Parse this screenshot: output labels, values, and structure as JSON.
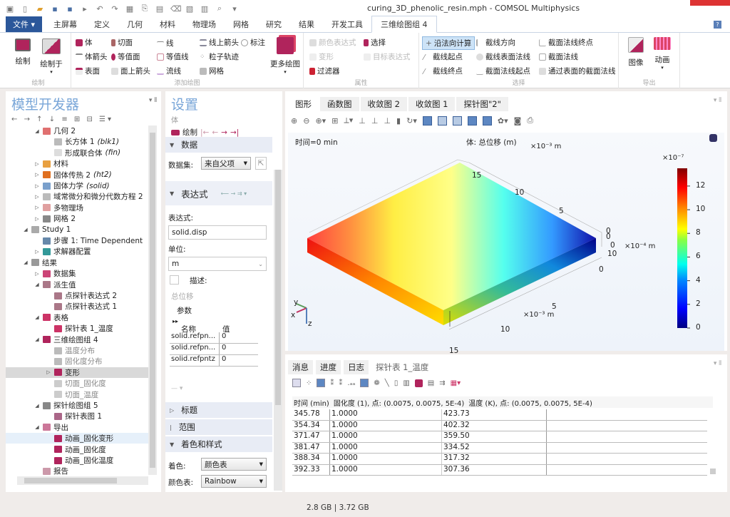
{
  "window": {
    "title": "curing_3D_phenolic_resin.mph - COMSOL Multiphysics"
  },
  "quick_access": [
    "app-icon",
    "new-icon",
    "open-icon",
    "save-icon",
    "save-as-icon",
    "run-icon",
    "undo-icon",
    "redo-icon",
    "table-icon",
    "cut-icon",
    "copy-icon",
    "delete-icon",
    "view-icon",
    "graph-icon",
    "zoom-icon",
    "more-icon"
  ],
  "ribbon_tabs": [
    {
      "label": "文件 ▾",
      "type": "file"
    },
    {
      "label": "主屏幕"
    },
    {
      "label": "定义"
    },
    {
      "label": "几何"
    },
    {
      "label": "材料"
    },
    {
      "label": "物理场"
    },
    {
      "label": "网格"
    },
    {
      "label": "研究"
    },
    {
      "label": "结果"
    },
    {
      "label": "开发工具"
    },
    {
      "label": "三维绘图组 4",
      "active": true
    }
  ],
  "ribbon": {
    "group_plot": {
      "label": "绘制",
      "plot": "绘制",
      "plot_in": "绘制于"
    },
    "group_add_plot": {
      "label": "添加绘图",
      "items": [
        "体",
        "体箭头",
        "表面",
        "切面",
        "等值面",
        "面上箭头",
        "线",
        "等值线",
        "流线",
        "线上箭头",
        "粒子轨迹",
        "网格",
        "标注"
      ],
      "more_plots": "更多绘图"
    },
    "group_attributes": {
      "label": "属性",
      "items": [
        {
          "label": "颜色表达式",
          "disabled": true
        },
        {
          "label": "选择"
        },
        {
          "label": "变形",
          "disabled": true
        },
        {
          "label": "目标表达式",
          "disabled": true
        },
        {
          "label": "过滤器"
        }
      ]
    },
    "group_selection": {
      "label": "选择",
      "items": [
        "沿法向计算",
        "截线方向",
        "截面法线终点",
        "截线起点",
        "截线表面法线",
        "截面法线",
        "截线终点",
        "截面法线起点",
        "通过表面的截面法线"
      ]
    },
    "group_export": {
      "label": "导出",
      "image": "图像",
      "animation": "动画"
    }
  },
  "model_builder": {
    "title": "模型开发器",
    "tree": [
      {
        "label": "几何 2",
        "level": 2,
        "toggle": "open",
        "color": "#e07070"
      },
      {
        "label": "长方体 1 ",
        "suffix": "(blk1)",
        "level": 3,
        "color": "#bbb"
      },
      {
        "label": "形成联合体 ",
        "suffix": "(fin)",
        "level": 3,
        "color": "#ddd"
      },
      {
        "label": "材料",
        "level": 2,
        "toggle": "closed",
        "color": "#e8a040"
      },
      {
        "label": "固体传热 2 ",
        "suffix": "(ht2)",
        "level": 2,
        "toggle": "closed",
        "color": "#e07020"
      },
      {
        "label": "固体力学 ",
        "suffix": "(solid)",
        "level": 2,
        "toggle": "closed",
        "color": "#7aa0cc"
      },
      {
        "label": "域常微分和微分代数方程 2",
        "level": 2,
        "toggle": "closed",
        "color": "#bbb"
      },
      {
        "label": "多物理场",
        "level": 2,
        "toggle": "closed",
        "color": "#e0a0a0"
      },
      {
        "label": "网格 2",
        "level": 2,
        "toggle": "closed",
        "color": "#888"
      },
      {
        "label": "Study 1",
        "level": 1,
        "toggle": "open",
        "color": "#aaa"
      },
      {
        "label": "步骤 1: Time Dependent",
        "level": 2,
        "color": "#6688aa"
      },
      {
        "label": "求解器配置",
        "level": 2,
        "toggle": "closed",
        "color": "#339999"
      },
      {
        "label": "结果",
        "level": 1,
        "toggle": "open",
        "color": "#999"
      },
      {
        "label": "数据集",
        "level": 2,
        "toggle": "closed",
        "color": "#cc4477"
      },
      {
        "label": "派生值",
        "level": 2,
        "toggle": "open",
        "color": "#aa7788"
      },
      {
        "label": "点探针表达式 2",
        "level": 3,
        "color": "#aa7788"
      },
      {
        "label": "点探针表达式 1",
        "level": 3,
        "color": "#aa7788"
      },
      {
        "label": "表格",
        "level": 2,
        "toggle": "open",
        "color": "#cc3366"
      },
      {
        "label": "探针表 1_温度",
        "level": 3,
        "color": "#cc3366"
      },
      {
        "label": "三维绘图组 4",
        "level": 2,
        "toggle": "open",
        "color": "#b0245c"
      },
      {
        "label": "温度分布",
        "level": 3,
        "color": "#bbb",
        "gray": true
      },
      {
        "label": "固化度分布",
        "level": 3,
        "color": "#bbb",
        "gray": true
      },
      {
        "label": "变形",
        "level": 3,
        "toggle": "closed",
        "color": "#b0245c",
        "selected": true
      },
      {
        "label": "切面_固化度",
        "level": 3,
        "color": "#ccc",
        "gray": true
      },
      {
        "label": "切面_温度",
        "level": 3,
        "color": "#ccc",
        "gray": true
      },
      {
        "label": "探针绘图组 5",
        "level": 2,
        "toggle": "open",
        "color": "#888"
      },
      {
        "label": "探针表图 1",
        "level": 3,
        "color": "#aa6688"
      },
      {
        "label": "导出",
        "level": 2,
        "toggle": "open",
        "color": "#cc7799"
      },
      {
        "label": "动画_固化变形",
        "level": 3,
        "color": "#b0245c",
        "hover": true
      },
      {
        "label": "动画_固化度",
        "level": 3,
        "color": "#b0245c"
      },
      {
        "label": "动画_固化温度",
        "level": 3,
        "color": "#b0245c"
      },
      {
        "label": "报告",
        "level": 2,
        "color": "#cc99aa"
      }
    ]
  },
  "settings": {
    "title": "设置",
    "subtitle": "体",
    "plot_label": "绘制",
    "section_data": "数据",
    "dataset_label": "数据集:",
    "dataset_value": "来自父项",
    "section_expression": "表达式",
    "expression_label": "表达式:",
    "expression_value": "solid.disp",
    "unit_label": "单位:",
    "unit_value": "m",
    "description_label": "描述:",
    "description_checked": false,
    "description_value": "总位移",
    "params_label": "参数",
    "params_headers": [
      "名称",
      "值"
    ],
    "params_rows": [
      [
        "solid.refpn...",
        "0"
      ],
      [
        "solid.refpn...",
        "0"
      ],
      [
        "solid.refpntz",
        "0"
      ]
    ],
    "section_title": "标题",
    "section_range": "范围",
    "section_coloring": "着色和样式",
    "coloring_label": "着色:",
    "coloring_value": "颜色表",
    "color_table_label": "颜色表:",
    "color_table_value": "Rainbow"
  },
  "graphics": {
    "tabs": [
      "图形",
      "函数图",
      "收敛图 2",
      "收敛图 1",
      "探针图\"2\""
    ],
    "time_label": "时间=0 min",
    "plot_title": "体: 总位移 (m)",
    "colorbar": {
      "exponent": "×10⁻⁷",
      "ticks": [
        "12",
        "10",
        "8",
        "6",
        "4",
        "2",
        "0"
      ],
      "range": [
        0,
        13.5
      ],
      "colormap": "Rainbow"
    },
    "axes": {
      "y_ticks": [
        "15",
        "10",
        "5",
        "0"
      ],
      "y_unit": "×10⁻³ m",
      "x_ticks": [
        "0",
        "5",
        "10",
        "15"
      ],
      "x_unit": "×10⁻³ m",
      "z_ticks": [
        "0",
        "0",
        "10"
      ],
      "z_unit": "×10⁻⁴ m"
    },
    "triad": {
      "x": "x",
      "y": "y",
      "z": "z"
    }
  },
  "messages": {
    "tabs": [
      "消息",
      "进度",
      "日志",
      "探针表 1_温度"
    ],
    "header": [
      "时间 (min)",
      "固化度 (1), 点: (0.0075, 0.0075, 5E-4)",
      "温度 (K), 点: (0.0075, 0.0075, 5E-4)"
    ],
    "rows": [
      [
        "345.78",
        "1.0000",
        "423.73"
      ],
      [
        "354.34",
        "1.0000",
        "402.32"
      ],
      [
        "371.47",
        "1.0000",
        "359.50"
      ],
      [
        "381.47",
        "1.0000",
        "334.52"
      ],
      [
        "388.34",
        "1.0000",
        "317.32"
      ],
      [
        "392.33",
        "1.0000",
        "307.36"
      ]
    ]
  },
  "status": {
    "memory": "2.8 GB | 3.72 GB"
  }
}
